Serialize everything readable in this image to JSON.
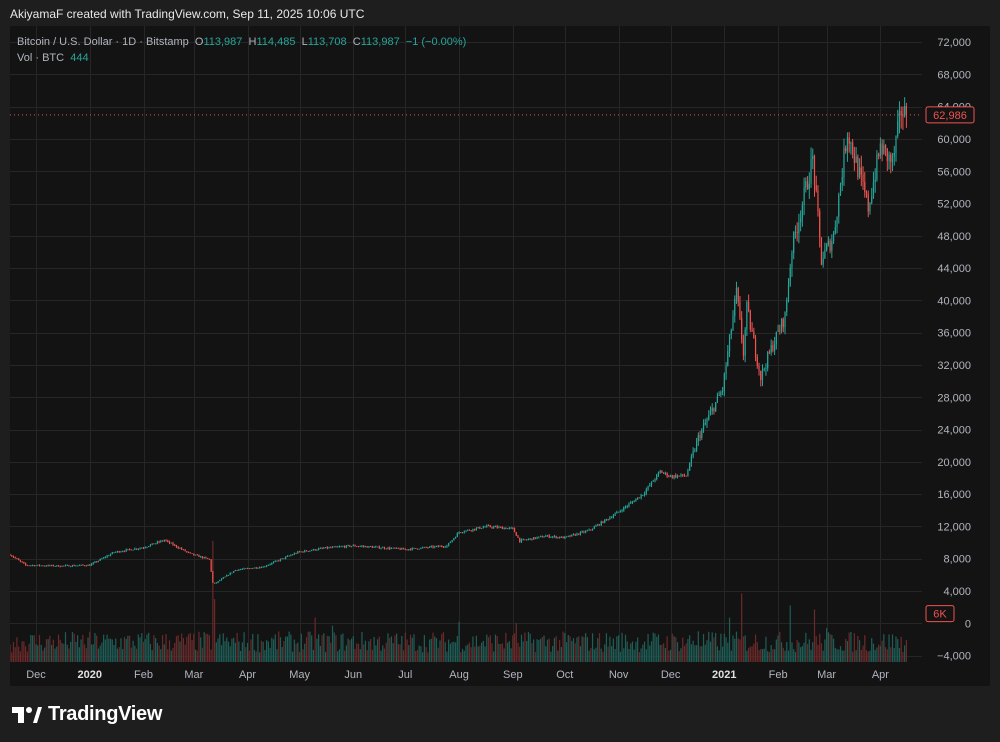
{
  "credit": "AkiyamaF created with TradingView.com, Sep 11, 2025 10:06 UTC",
  "legend": {
    "symbol": "Bitcoin / U.S. Dollar · 1D · Bitstamp",
    "o_label": "O",
    "o_value": "113,987",
    "h_label": "H",
    "h_value": "114,485",
    "l_label": "L",
    "l_value": "113,708",
    "c_label": "C",
    "c_value": "113,987",
    "change": "−1 (−0.00%)",
    "vol_label": "Vol · BTC",
    "vol_value": "444"
  },
  "footer": {
    "brand": "TradingView"
  },
  "colors": {
    "up": "#26a69a",
    "down": "#ef5350",
    "background": "#131313",
    "grid": "#262626"
  },
  "chart_data": {
    "type": "candlestick",
    "price_labels": [
      "72,000",
      "68,000",
      "64,000",
      "60,000",
      "56,000",
      "52,000",
      "48,000",
      "44,000",
      "40,000",
      "36,000",
      "32,000",
      "28,000",
      "24,000",
      "20,000",
      "16,000",
      "12,000",
      "8,000",
      "4,000",
      "0",
      "−4,000"
    ],
    "price_values": [
      72000,
      68000,
      64000,
      60000,
      56000,
      52000,
      48000,
      44000,
      40000,
      36000,
      32000,
      28000,
      24000,
      20000,
      16000,
      12000,
      8000,
      4000,
      0,
      -4000
    ],
    "ylim": [
      -4800,
      74000
    ],
    "x_ticks": [
      {
        "label": "Dec",
        "date": "2019-12-01"
      },
      {
        "label": "2020",
        "date": "2020-01-01",
        "bold": true
      },
      {
        "label": "Feb",
        "date": "2020-02-01"
      },
      {
        "label": "Mar",
        "date": "2020-03-01"
      },
      {
        "label": "Apr",
        "date": "2020-04-01"
      },
      {
        "label": "May",
        "date": "2020-05-01"
      },
      {
        "label": "Jun",
        "date": "2020-06-01"
      },
      {
        "label": "Jul",
        "date": "2020-07-01"
      },
      {
        "label": "Aug",
        "date": "2020-08-01"
      },
      {
        "label": "Sep",
        "date": "2020-09-01"
      },
      {
        "label": "Oct",
        "date": "2020-10-01"
      },
      {
        "label": "Nov",
        "date": "2020-11-01"
      },
      {
        "label": "Dec",
        "date": "2020-12-01"
      },
      {
        "label": "2021",
        "date": "2021-01-01",
        "bold": true
      },
      {
        "label": "Feb",
        "date": "2021-02-01"
      },
      {
        "label": "Mar",
        "date": "2021-03-01"
      },
      {
        "label": "Apr",
        "date": "2021-04-01"
      }
    ],
    "x_range": [
      "2019-11-16",
      "2021-04-25"
    ],
    "last_price_label": "62,986",
    "last_price": 62986,
    "last_volume_label": "6K",
    "last_volume": 6000,
    "price_path": [
      [
        "2019-11-16",
        8500
      ],
      [
        "2019-11-25",
        7200
      ],
      [
        "2019-12-15",
        7100
      ],
      [
        "2020-01-01",
        7200
      ],
      [
        "2020-01-15",
        8800
      ],
      [
        "2020-02-01",
        9400
      ],
      [
        "2020-02-13",
        10300
      ],
      [
        "2020-02-28",
        8600
      ],
      [
        "2020-03-10",
        7900
      ],
      [
        "2020-03-12",
        5000
      ],
      [
        "2020-03-13",
        4900
      ],
      [
        "2020-03-25",
        6600
      ],
      [
        "2020-04-10",
        7000
      ],
      [
        "2020-04-30",
        8800
      ],
      [
        "2020-05-15",
        9300
      ],
      [
        "2020-06-01",
        9600
      ],
      [
        "2020-06-15",
        9400
      ],
      [
        "2020-07-01",
        9150
      ],
      [
        "2020-07-25",
        9600
      ],
      [
        "2020-08-01",
        11300
      ],
      [
        "2020-08-17",
        12000
      ],
      [
        "2020-09-01",
        11700
      ],
      [
        "2020-09-05",
        10200
      ],
      [
        "2020-09-20",
        10800
      ],
      [
        "2020-10-01",
        10600
      ],
      [
        "2020-10-15",
        11500
      ],
      [
        "2020-11-01",
        13800
      ],
      [
        "2020-11-15",
        16000
      ],
      [
        "2020-11-25",
        18800
      ],
      [
        "2020-12-01",
        18200
      ],
      [
        "2020-12-10",
        18300
      ],
      [
        "2020-12-17",
        23000
      ],
      [
        "2020-12-31",
        29000
      ],
      [
        "2021-01-08",
        41000
      ],
      [
        "2021-01-12",
        33500
      ],
      [
        "2021-01-14",
        39000
      ],
      [
        "2021-01-22",
        30500
      ],
      [
        "2021-01-28",
        34000
      ],
      [
        "2021-02-05",
        38000
      ],
      [
        "2021-02-09",
        46500
      ],
      [
        "2021-02-21",
        57500
      ],
      [
        "2021-02-26",
        45000
      ],
      [
        "2021-03-05",
        48000
      ],
      [
        "2021-03-13",
        61000
      ],
      [
        "2021-03-25",
        51500
      ],
      [
        "2021-04-01",
        59000
      ],
      [
        "2021-04-08",
        57000
      ],
      [
        "2021-04-13",
        63500
      ],
      [
        "2021-04-16",
        62986
      ]
    ],
    "volume_spikes": [
      [
        "2020-03-12",
        15000
      ],
      [
        "2020-03-13",
        7800
      ],
      [
        "2020-05-10",
        5500
      ],
      [
        "2020-05-20",
        4500
      ],
      [
        "2020-08-01",
        5000
      ],
      [
        "2020-09-03",
        4800
      ],
      [
        "2020-12-17",
        3800
      ],
      [
        "2021-01-04",
        5500
      ],
      [
        "2021-01-11",
        8500
      ],
      [
        "2021-02-08",
        7000
      ],
      [
        "2021-02-22",
        6500
      ],
      [
        "2021-03-01",
        4200
      ]
    ]
  }
}
